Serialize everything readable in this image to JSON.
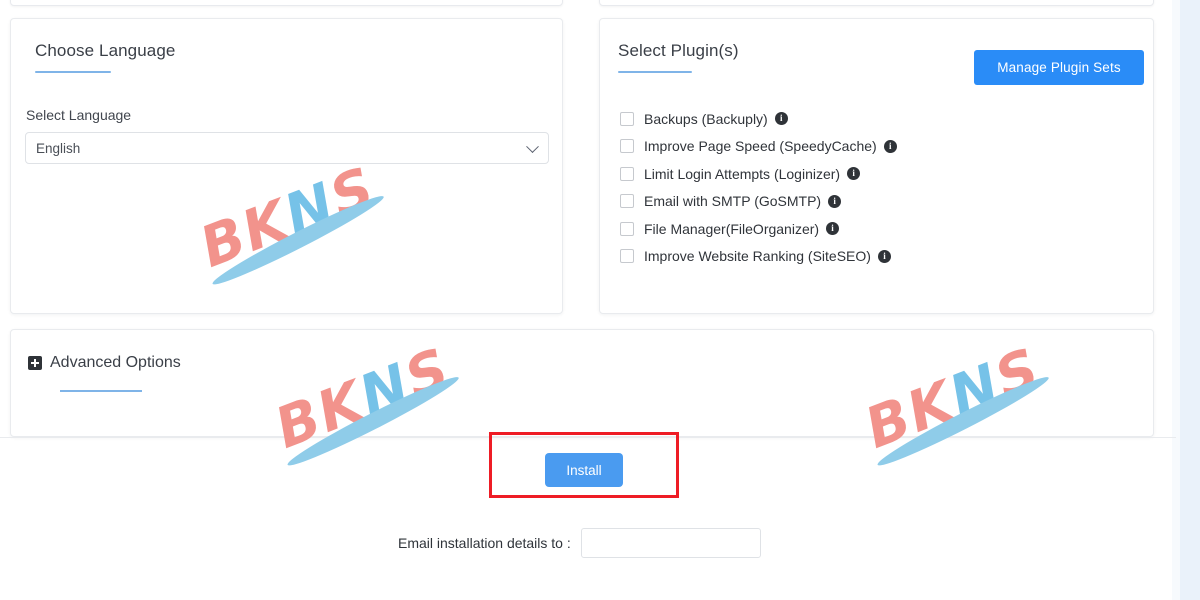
{
  "language_card": {
    "title": "Choose Language",
    "field_label": "Select Language",
    "select_value": "English",
    "select_options": [
      "English"
    ],
    "caret_icon": "chevron-down-icon"
  },
  "plugins_card": {
    "title": "Select Plugin(s)",
    "manage_button": "Manage Plugin Sets",
    "manage_button_color": "#2a8cf7",
    "items": [
      {
        "label": "Backups (Backuply)",
        "checked": false,
        "info_icon": "info-icon"
      },
      {
        "label": "Improve Page Speed (SpeedyCache)",
        "checked": false,
        "info_icon": "info-icon"
      },
      {
        "label": "Limit Login Attempts (Loginizer)",
        "checked": false,
        "info_icon": "info-icon"
      },
      {
        "label": "Email with SMTP (GoSMTP)",
        "checked": false,
        "info_icon": "info-icon"
      },
      {
        "label": "File Manager(FileOrganizer)",
        "checked": false,
        "info_icon": "info-icon"
      },
      {
        "label": "Improve Website Ranking (SiteSEO)",
        "checked": false,
        "info_icon": "info-icon"
      }
    ]
  },
  "advanced_card": {
    "title": "Advanced Options",
    "expand_icon": "plus-square-icon"
  },
  "actions": {
    "install_label": "Install",
    "install_color": "#4a9bf0",
    "highlight_color": "#ee1c25"
  },
  "email": {
    "label": "Email installation details to :",
    "value": "",
    "placeholder": ""
  },
  "watermarks": [
    {
      "text": "BKNS",
      "letters": [
        "B",
        "K",
        "N",
        "S"
      ]
    },
    {
      "text": "BKNS",
      "letters": [
        "B",
        "K",
        "N",
        "S"
      ]
    },
    {
      "text": "BKNS",
      "letters": [
        "B",
        "K",
        "N",
        "S"
      ]
    }
  ],
  "theme": {
    "accent_blue": "#7fb4e8",
    "card_border": "#e9ebee",
    "text_primary": "#3a3f47",
    "watermark_salmon": "#f2938c",
    "watermark_blue": "#76c2e8"
  }
}
